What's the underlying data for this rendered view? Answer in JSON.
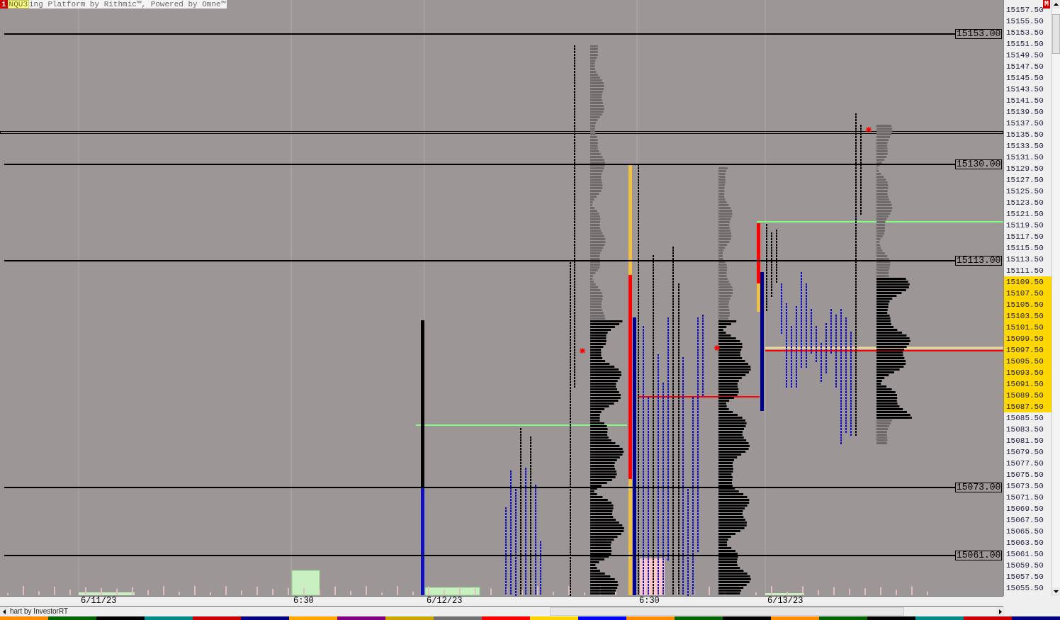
{
  "window": {
    "badge": "i",
    "symbol": "NQU3",
    "title": "ing Platform by Rithmic™, Powered by Omne™",
    "corner_badge": "M"
  },
  "levels": [
    {
      "label": "15153.00"
    },
    {
      "label": "15130.00"
    },
    {
      "label": "15113.00"
    },
    {
      "label": "15073.00"
    },
    {
      "label": "15061.00"
    }
  ],
  "price_axis": {
    "labels": [
      {
        "text": "15157.50",
        "value_area": false
      },
      {
        "text": "15155.50",
        "value_area": false
      },
      {
        "text": "15153.50",
        "value_area": false
      },
      {
        "text": "15151.50",
        "value_area": false
      },
      {
        "text": "15149.50",
        "value_area": false
      },
      {
        "text": "15147.50",
        "value_area": false
      },
      {
        "text": "15145.50",
        "value_area": false
      },
      {
        "text": "15143.50",
        "value_area": false
      },
      {
        "text": "15141.50",
        "value_area": false
      },
      {
        "text": "15139.50",
        "value_area": false
      },
      {
        "text": "15137.50",
        "value_area": false
      },
      {
        "text": "15135.50",
        "value_area": false
      },
      {
        "text": "15133.50",
        "value_area": false
      },
      {
        "text": "15131.50",
        "value_area": false
      },
      {
        "text": "15129.50",
        "value_area": false
      },
      {
        "text": "15127.50",
        "value_area": false
      },
      {
        "text": "15125.50",
        "value_area": false
      },
      {
        "text": "15123.50",
        "value_area": false
      },
      {
        "text": "15121.50",
        "value_area": false
      },
      {
        "text": "15119.50",
        "value_area": false
      },
      {
        "text": "15117.50",
        "value_area": false
      },
      {
        "text": "15115.50",
        "value_area": false
      },
      {
        "text": "15113.50",
        "value_area": false
      },
      {
        "text": "15111.50",
        "value_area": false
      },
      {
        "text": "15109.50",
        "value_area": true
      },
      {
        "text": "15107.50",
        "value_area": true
      },
      {
        "text": "15105.50",
        "value_area": true
      },
      {
        "text": "15103.50",
        "value_area": true
      },
      {
        "text": "15101.50",
        "value_area": true
      },
      {
        "text": "15099.50",
        "value_area": true
      },
      {
        "text": "15097.50",
        "value_area": true
      },
      {
        "text": "15095.50",
        "value_area": true
      },
      {
        "text": "15093.50",
        "value_area": true
      },
      {
        "text": "15091.50",
        "value_area": true
      },
      {
        "text": "15089.50",
        "value_area": true
      },
      {
        "text": "15087.50",
        "value_area": true
      },
      {
        "text": "15085.50",
        "value_area": false
      },
      {
        "text": "15083.50",
        "value_area": false
      },
      {
        "text": "15081.50",
        "value_area": false
      },
      {
        "text": "15079.50",
        "value_area": false
      },
      {
        "text": "15077.50",
        "value_area": false
      },
      {
        "text": "15075.50",
        "value_area": false
      },
      {
        "text": "15073.50",
        "value_area": false
      },
      {
        "text": "15071.50",
        "value_area": false
      },
      {
        "text": "15069.50",
        "value_area": false
      },
      {
        "text": "15067.50",
        "value_area": false
      },
      {
        "text": "15065.50",
        "value_area": false
      },
      {
        "text": "15063.50",
        "value_area": false
      },
      {
        "text": "15061.50",
        "value_area": false
      },
      {
        "text": "15059.50",
        "value_area": false
      },
      {
        "text": "15057.50",
        "value_area": false
      },
      {
        "text": "15055.50",
        "value_area": false
      }
    ]
  },
  "time_axis": {
    "labels": [
      "6/11/23",
      "6:30",
      "6/12/23",
      "6:30",
      "6/13/23"
    ]
  },
  "footer": {
    "credit": "hart by InvestorRT"
  }
}
